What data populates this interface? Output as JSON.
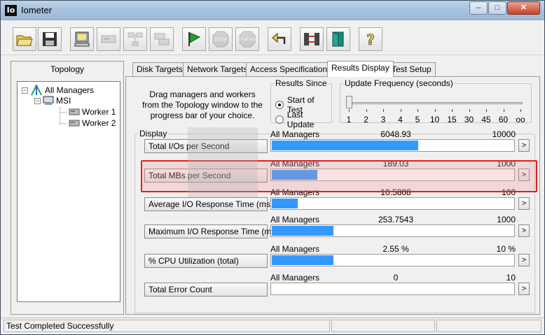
{
  "window": {
    "app_icon_text": "Io",
    "title": "Iometer",
    "minimize": "–",
    "maximize": "□",
    "close": "✕"
  },
  "toolbar": {
    "buttons": [
      {
        "name": "open-config",
        "icon": "folder-open-icon"
      },
      {
        "name": "save-config",
        "icon": "floppy-disk-icon"
      },
      {
        "name": "start-new-manager",
        "icon": "computer-icon"
      },
      {
        "name": "start-new-disk-worker",
        "icon": "disk-worker-icon"
      },
      {
        "name": "start-new-network-worker",
        "icon": "network-worker-icon"
      },
      {
        "name": "duplicate-worker",
        "icon": "duplicate-worker-icon"
      },
      {
        "name": "start-tests",
        "icon": "green-flag-icon"
      },
      {
        "name": "stop-test",
        "icon": "stop-sign-icon",
        "label": "STOP"
      },
      {
        "name": "stop-all",
        "icon": "stop-all-icon",
        "label": "STOP ALL"
      },
      {
        "name": "reset-workers",
        "icon": "reset-arrow-icon"
      },
      {
        "name": "disconnect-managers",
        "icon": "disconnect-icon"
      },
      {
        "name": "exit",
        "icon": "exit-door-icon"
      },
      {
        "name": "about",
        "icon": "question-mark-icon",
        "label": "?"
      }
    ]
  },
  "topology": {
    "title": "Topology",
    "root": "All Managers",
    "manager": "MSI",
    "workers": [
      "Worker 1",
      "Worker 2"
    ]
  },
  "tabs": [
    "Disk Targets",
    "Network Targets",
    "Access Specifications",
    "Results Display",
    "Test Setup"
  ],
  "active_tab": "Results Display",
  "results": {
    "instructions": "Drag managers and workers from the Topology window to the progress bar of your choice.",
    "results_since": {
      "legend": "Results Since",
      "options": [
        "Start of Test",
        "Last Update"
      ],
      "selected": "Start of Test"
    },
    "update_frequency": {
      "legend": "Update Frequency (seconds)",
      "ticks": [
        "1",
        "2",
        "3",
        "4",
        "5",
        "10",
        "15",
        "30",
        "45",
        "60",
        "oo"
      ],
      "selected": "1"
    },
    "display_legend": "Display",
    "metrics": [
      {
        "button": "Total I/Os per Second",
        "source": "All Managers",
        "value": "6048.93",
        "max": "10000",
        "fill": 0.605
      },
      {
        "button": "Total MBs per Second",
        "source": "All Managers",
        "value": "189.03",
        "max": "1000",
        "fill": 0.189
      },
      {
        "button": "Average I/O Response Time (ms)",
        "source": "All Managers",
        "value": "10.5808",
        "max": "100",
        "fill": 0.106
      },
      {
        "button": "Maximum I/O Response Time (ms)",
        "source": "All Managers",
        "value": "253.7543",
        "max": "1000",
        "fill": 0.254
      },
      {
        "button": "% CPU Utilization (total)",
        "source": "All Managers",
        "value": "2.55 %",
        "max": "10 %",
        "fill": 0.255
      },
      {
        "button": "Total Error Count",
        "source": "All Managers",
        "value": "0",
        "max": "10",
        "fill": 0
      }
    ],
    "more_label": ">"
  },
  "status": {
    "text": "Test Completed Successfully"
  },
  "colors": {
    "bar": "#3399ff",
    "highlight": "#e02020"
  }
}
